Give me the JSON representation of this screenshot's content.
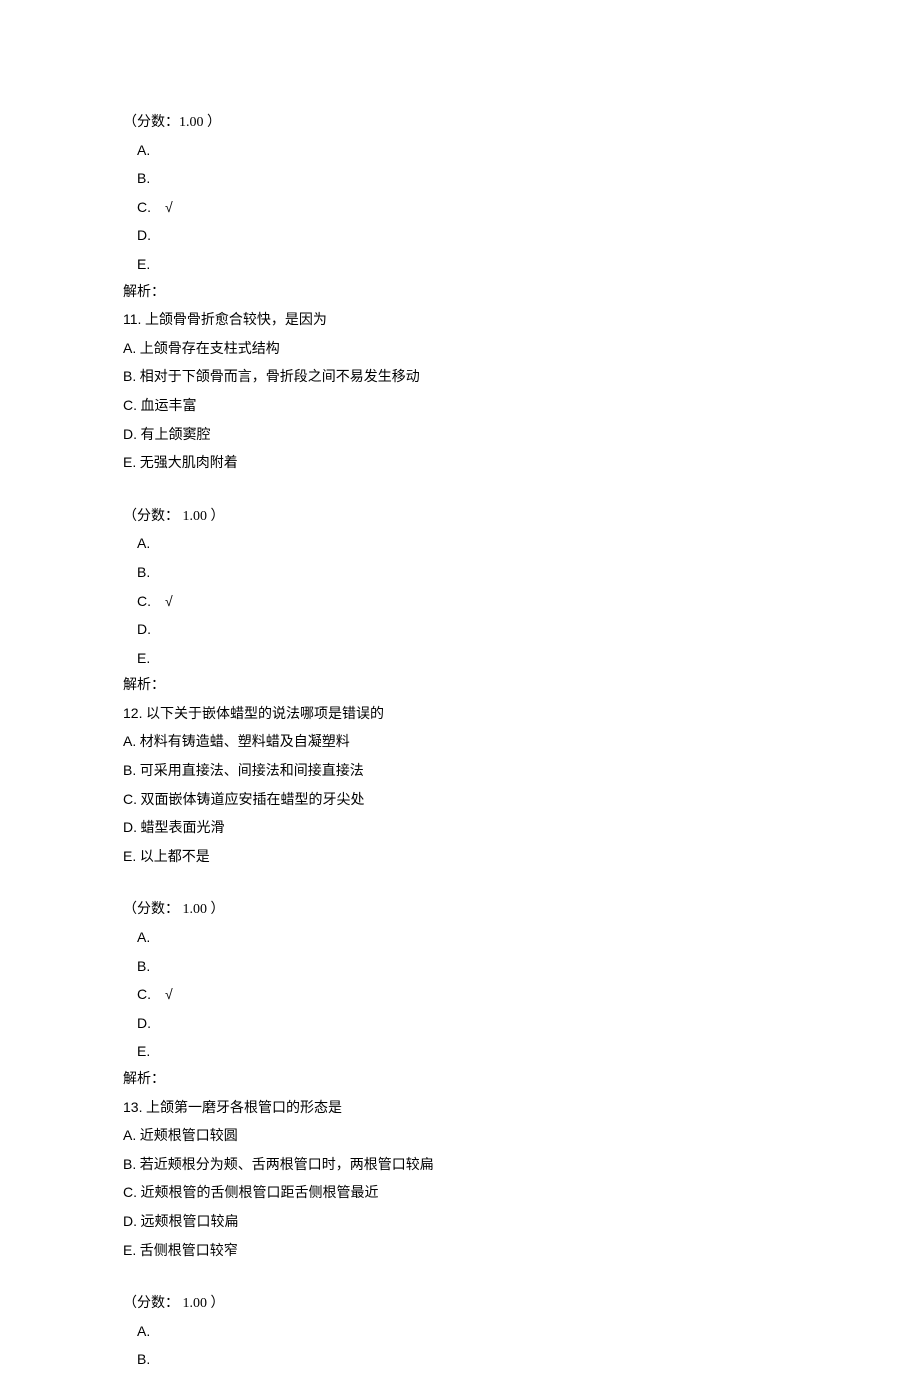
{
  "q10_tail": {
    "score": "（分数：1.00 ）",
    "options": [
      "A.",
      "B.",
      "C.",
      "D.",
      "E."
    ],
    "correct_index": 2,
    "check": "√",
    "jiexi": "解析："
  },
  "q11": {
    "number": "11.",
    "stem": "上颌骨骨折愈合较快，是因为",
    "choices": [
      {
        "letter": "A.",
        "text": "上颌骨存在支柱式结构"
      },
      {
        "letter": "B.",
        "text": "相对于下颌骨而言，骨折段之间不易发生移动"
      },
      {
        "letter": "C.",
        "text": "血运丰富"
      },
      {
        "letter": "D.",
        "text": "有上颌窦腔"
      },
      {
        "letter": "E.",
        "text": "无强大肌肉附着"
      }
    ],
    "score": "（分数： 1.00 ）",
    "options": [
      "A.",
      "B.",
      "C.",
      "D.",
      "E."
    ],
    "correct_index": 2,
    "check": "√",
    "jiexi": "解析："
  },
  "q12": {
    "number": "12.",
    "stem": "以下关于嵌体蜡型的说法哪项是错误的",
    "choices": [
      {
        "letter": "A.",
        "text": "材料有铸造蜡、塑料蜡及自凝塑料"
      },
      {
        "letter": "B.",
        "text": "可采用直接法、间接法和间接直接法"
      },
      {
        "letter": "C.",
        "text": "双面嵌体铸道应安插在蜡型的牙尖处"
      },
      {
        "letter": "D.",
        "text": "蜡型表面光滑"
      },
      {
        "letter": "E.",
        "text": "以上都不是"
      }
    ],
    "score": "（分数： 1.00 ）",
    "options": [
      "A.",
      "B.",
      "C.",
      "D.",
      "E."
    ],
    "correct_index": 2,
    "check": "√",
    "jiexi": "解析："
  },
  "q13": {
    "number": "13.",
    "stem": "上颌第一磨牙各根管口的形态是",
    "choices": [
      {
        "letter": "A.",
        "text": "近颊根管口较圆"
      },
      {
        "letter": "B.",
        "text": "若近颊根分为颊、舌两根管口时，两根管口较扁"
      },
      {
        "letter": "C.",
        "text": "近颊根管的舌侧根管口距舌侧根管最近"
      },
      {
        "letter": "D.",
        "text": "远颊根管口较扁"
      },
      {
        "letter": "E.",
        "text": "舌侧根管口较窄"
      }
    ],
    "score": "（分数： 1.00 ）",
    "options": [
      "A.",
      "B."
    ]
  }
}
